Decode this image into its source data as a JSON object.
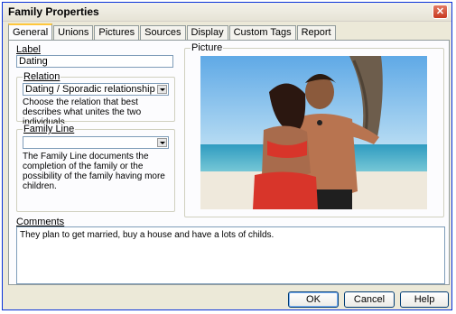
{
  "window": {
    "title": "Family Properties"
  },
  "tabs": [
    "General",
    "Unions",
    "Pictures",
    "Sources",
    "Display",
    "Custom Tags",
    "Report"
  ],
  "label_section": {
    "label": "Label",
    "value": "Dating"
  },
  "relation": {
    "label": "Relation",
    "selected": "Dating / Sporadic relationship",
    "description": "Choose the relation that best describes what unites the two individuals."
  },
  "family_line": {
    "label": "Family Line",
    "selected": "",
    "description": "The Family Line documents the completion of the family or the possibility of the family having more children."
  },
  "picture": {
    "label": "Picture"
  },
  "comments": {
    "label": "Comments",
    "value": "They plan to get married, buy a house and have a lots of childs."
  },
  "buttons": {
    "ok": "OK",
    "cancel": "Cancel",
    "help": "Help"
  },
  "icons": {
    "close": "close-icon",
    "dropdown": "chevron-down-icon"
  },
  "colors": {
    "title_border": "#0831d9",
    "close_button": "#c83a21",
    "active_tab_accent": "#ffc73c"
  }
}
